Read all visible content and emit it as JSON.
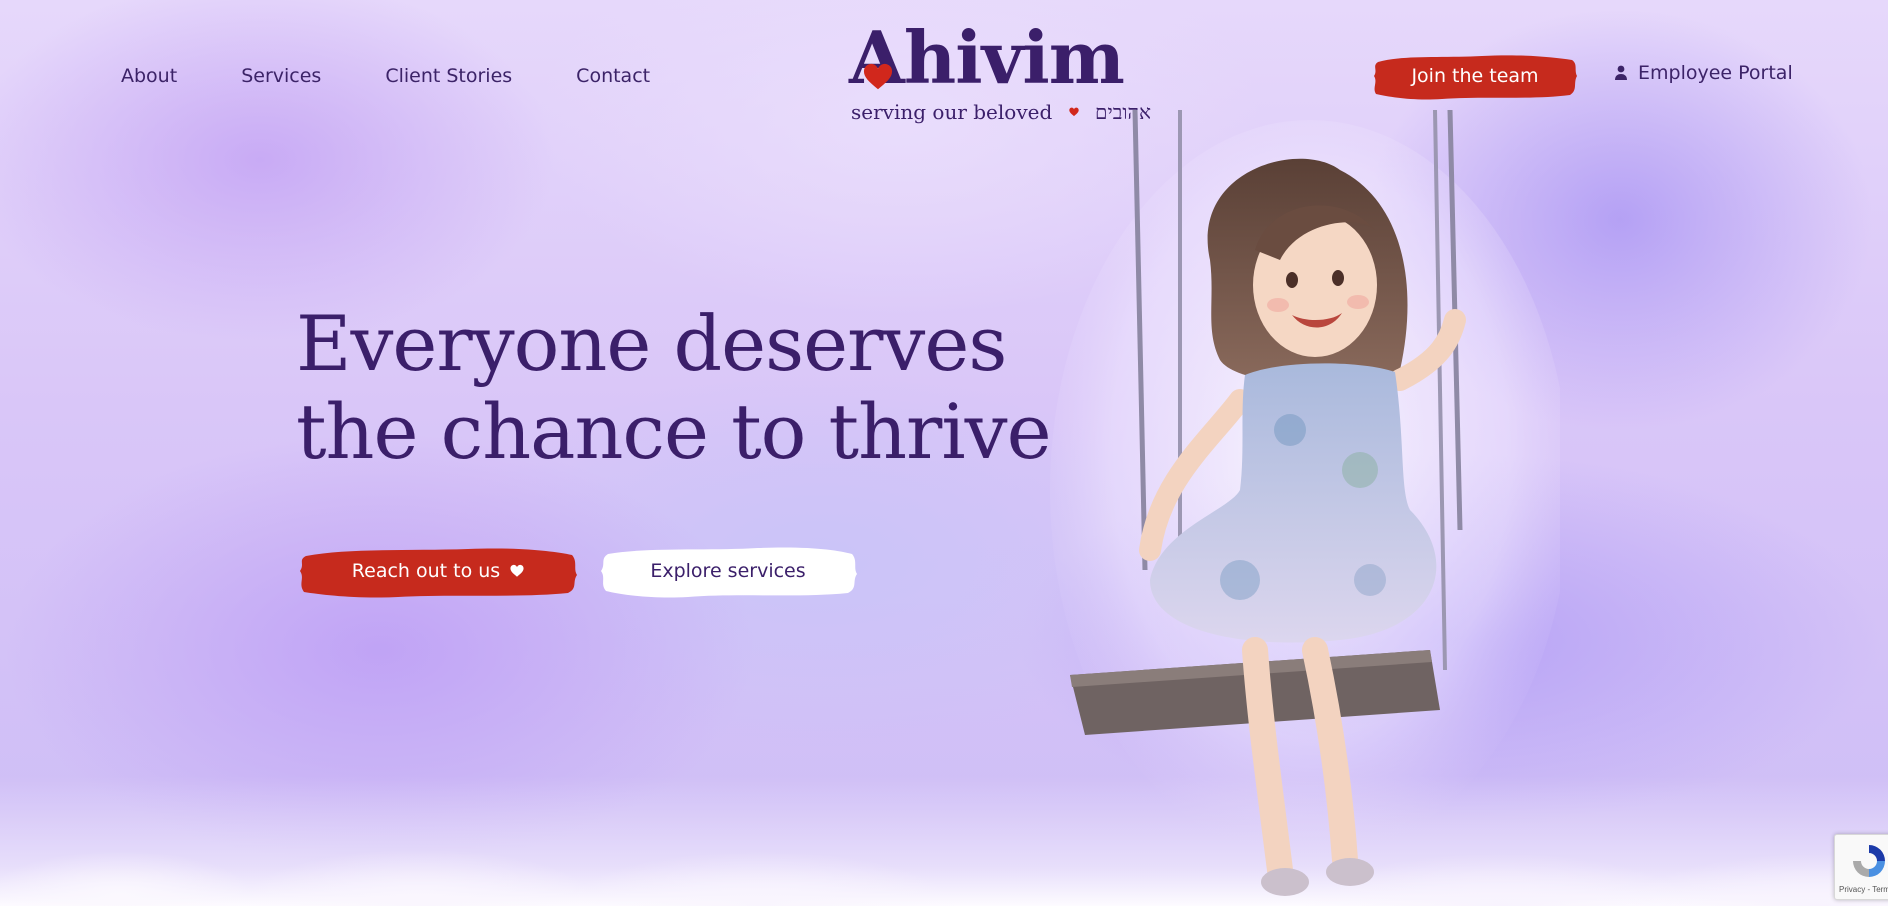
{
  "nav": {
    "links": [
      {
        "label": "About"
      },
      {
        "label": "Services"
      },
      {
        "label": "Client Stories"
      },
      {
        "label": "Contact"
      }
    ]
  },
  "logo": {
    "wordmark": "Ahivim",
    "tagline": "serving our beloved",
    "tagline_hebrew": "אהובים"
  },
  "header_actions": {
    "join_label": "Join the team",
    "portal_label": "Employee Portal"
  },
  "hero": {
    "headline_line1": "Everyone deserves",
    "headline_line2": "the chance to thrive",
    "primary_cta": "Reach out to us",
    "secondary_cta": "Explore services"
  },
  "recaptcha": {
    "footer_text": "Privacy - Terms"
  },
  "icons": {
    "logo_heart": "heart-icon",
    "cta_heart": "heart-icon",
    "portal": "person-icon",
    "recaptcha": "recaptcha-icon"
  },
  "colors": {
    "primary_purple": "#3b1f6a",
    "accent_red": "#c62a1d",
    "background_lavender": "#e4d6fa",
    "white_brush": "#ffffff"
  }
}
